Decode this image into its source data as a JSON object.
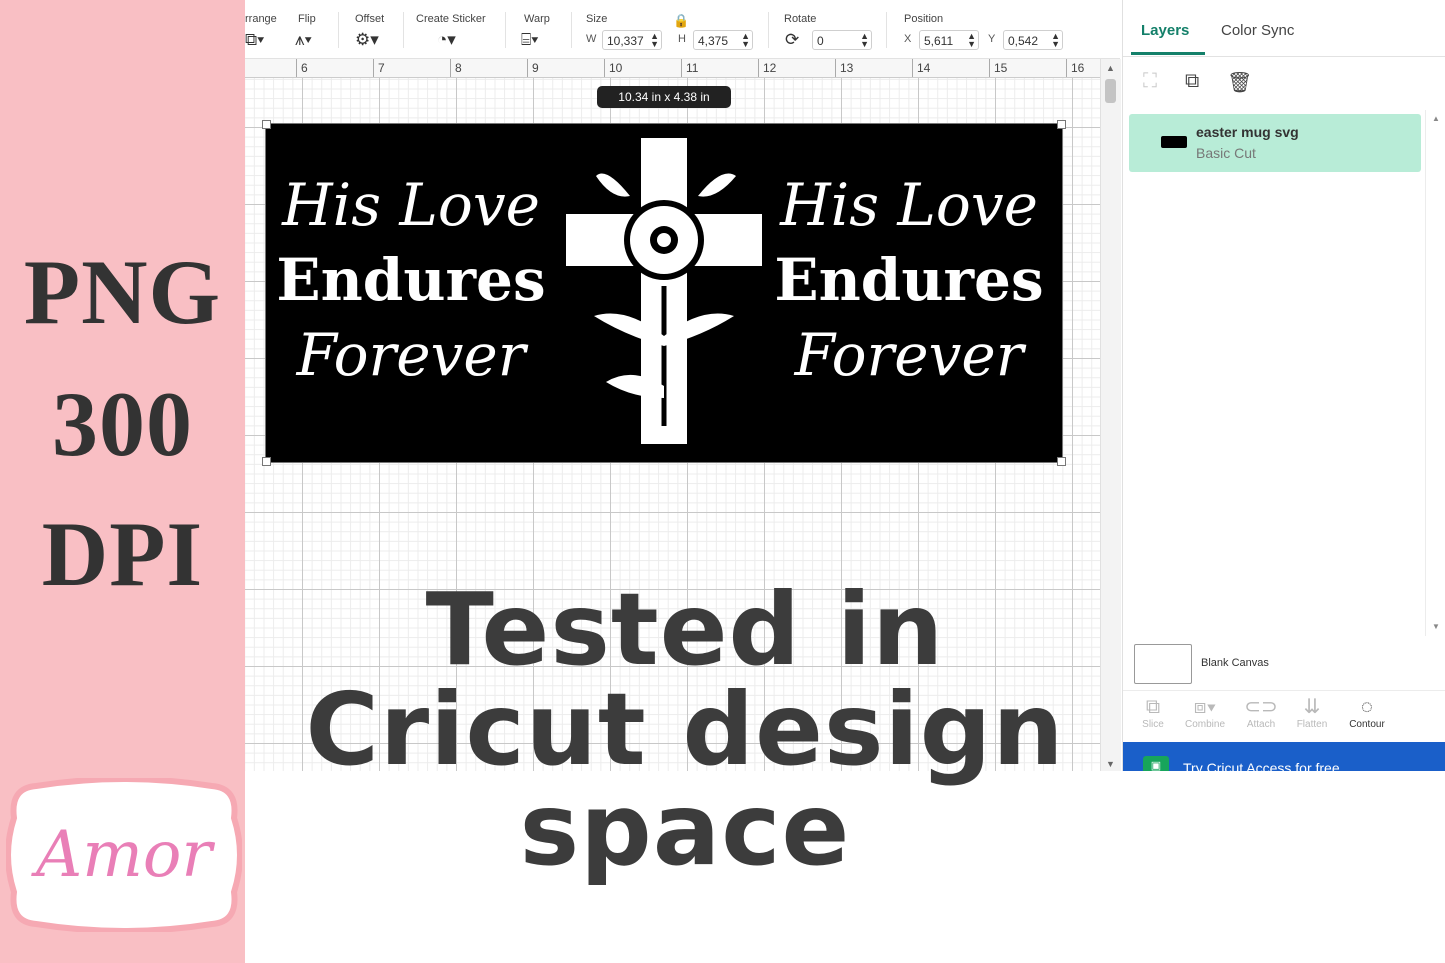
{
  "promo": {
    "lines": [
      "PNG",
      "300",
      "DPI"
    ],
    "logo_text": "Amor",
    "headline": [
      "Tested in",
      "Cricut design",
      "space"
    ]
  },
  "toolbar": {
    "arrange_label": "rrange",
    "flip_label": "Flip",
    "offset_label": "Offset",
    "sticker_label": "Create Sticker",
    "warp_label": "Warp",
    "size_label": "Size",
    "size_w_label": "W",
    "size_w_value": "10,337",
    "size_h_label": "H",
    "size_h_value": "4,375",
    "rotate_label": "Rotate",
    "rotate_value": "0",
    "position_label": "Position",
    "pos_x_label": "X",
    "pos_x_value": "5,611",
    "pos_y_label": "Y",
    "pos_y_value": "0,542"
  },
  "ruler": {
    "marks": [
      "6",
      "7",
      "8",
      "9",
      "10",
      "11",
      "12",
      "13",
      "14",
      "15",
      "16"
    ]
  },
  "canvas": {
    "size_tooltip": "10.34  in x 4.38  in",
    "design": {
      "left_lines": [
        "His Love",
        "Endures",
        "Forever"
      ],
      "right_lines": [
        "His Love",
        "Endures",
        "Forever"
      ]
    }
  },
  "panel": {
    "tabs": [
      {
        "label": "Layers",
        "active": true
      },
      {
        "label": "Color Sync",
        "active": false
      }
    ],
    "layer": {
      "name": "easter mug svg",
      "operation": "Basic Cut"
    },
    "blank_canvas_label": "Blank Canvas",
    "tools": [
      {
        "label": "Slice",
        "enabled": false
      },
      {
        "label": "Combine",
        "enabled": false
      },
      {
        "label": "Attach",
        "enabled": false
      },
      {
        "label": "Flatten",
        "enabled": false
      },
      {
        "label": "Contour",
        "enabled": true
      }
    ],
    "access_banner": "Try Cricut Access for free"
  },
  "colors": {
    "accent": "#14806a",
    "left_band": "#f9bfc4",
    "layer_selected": "#b8ecd7",
    "banner": "#1a5fc9"
  }
}
